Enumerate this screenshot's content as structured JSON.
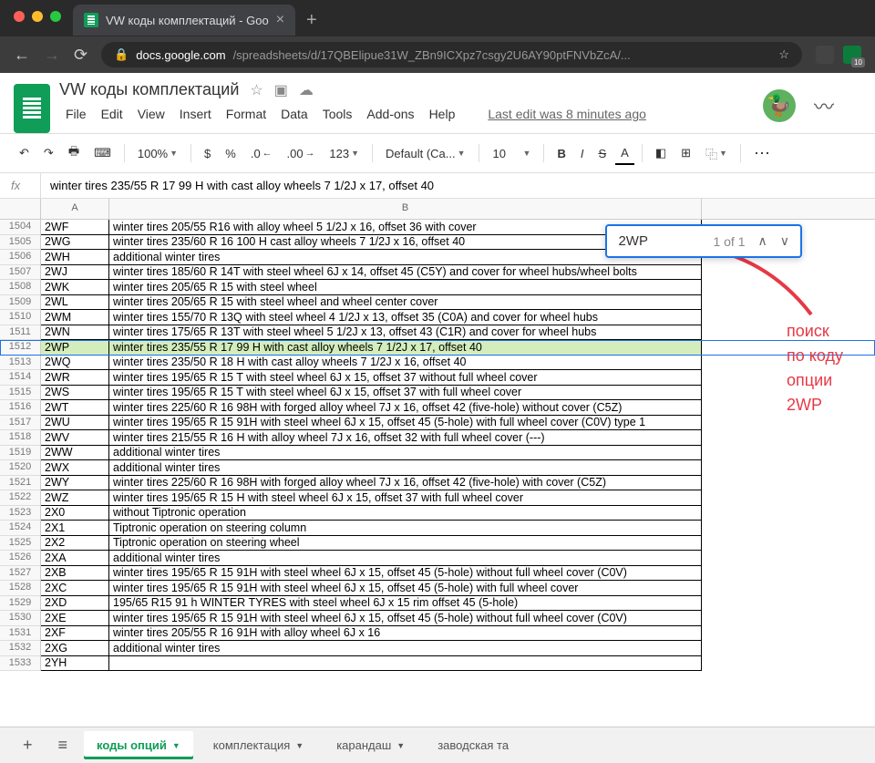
{
  "browser": {
    "tab_title": "VW коды комплектаций - Goo",
    "url_domain": "docs.google.com",
    "url_path": "/spreadsheets/d/17QBElipue31W_ZBn9ICXpz7csgy2U6AY90ptFNVbZcA/...",
    "ext_badge": "10"
  },
  "doc": {
    "title": "VW коды комплектаций",
    "last_edit": "Last edit was 8 minutes ago"
  },
  "menu": {
    "file": "File",
    "edit": "Edit",
    "view": "View",
    "insert": "Insert",
    "format": "Format",
    "data": "Data",
    "tools": "Tools",
    "addons": "Add-ons",
    "help": "Help"
  },
  "toolbar": {
    "zoom": "100%",
    "currency": "$",
    "percent": "%",
    "dec_dec": ".0",
    "dec_inc": ".00",
    "num123": "123",
    "font": "Default (Ca...",
    "font_size": "10",
    "bold": "B",
    "italic": "I",
    "strike": "S",
    "textcolor": "A"
  },
  "formula": {
    "fx": "fx",
    "value": "winter tires 235/55 R 17 99 H with cast alloy wheels 7 1/2J x 17, offset 40"
  },
  "columns": {
    "A": "A",
    "B": "B"
  },
  "find": {
    "query": "2WP",
    "count": "1 of 1"
  },
  "annotation": {
    "l1": "поиск",
    "l2": "по коду",
    "l3": "опции",
    "l4": "2WP"
  },
  "rows": [
    {
      "n": "1504",
      "a": "2WF",
      "b": "winter tires 205/55 R16 with alloy wheel 5 1/2J x 16, offset 36 with cover"
    },
    {
      "n": "1505",
      "a": "2WG",
      "b": "winter tires 235/60 R 16 100 H cast alloy wheels 7 1/2J x 16, offset 40"
    },
    {
      "n": "1506",
      "a": "2WH",
      "b": "additional winter tires"
    },
    {
      "n": "1507",
      "a": "2WJ",
      "b": "winter tires 185/60 R 14T with steel wheel 6J x 14, offset 45 (C5Y) and cover for wheel hubs/wheel bolts"
    },
    {
      "n": "1508",
      "a": "2WK",
      "b": "winter tires 205/65 R 15 with steel wheel"
    },
    {
      "n": "1509",
      "a": "2WL",
      "b": "winter tires 205/65 R 15 with steel wheel and wheel center cover"
    },
    {
      "n": "1510",
      "a": "2WM",
      "b": "winter tires 155/70 R 13Q with steel wheel 4 1/2J x 13, offset 35 (C0A) and cover for wheel hubs"
    },
    {
      "n": "1511",
      "a": "2WN",
      "b": "winter tires 175/65 R 13T with steel wheel 5 1/2J x 13, offset 43 (C1R) and cover for wheel hubs"
    },
    {
      "n": "1512",
      "a": "2WP",
      "b": "winter tires 235/55 R 17 99 H with cast alloy wheels 7 1/2J x 17, offset 40",
      "hl": true
    },
    {
      "n": "1513",
      "a": "2WQ",
      "b": "winter tires 235/50 R 18 H with cast alloy wheels 7 1/2J x 16, offset 40"
    },
    {
      "n": "1514",
      "a": "2WR",
      "b": "winter tires 195/65 R 15 T with steel wheel 6J x 15, offset 37 without full wheel cover"
    },
    {
      "n": "1515",
      "a": "2WS",
      "b": "winter tires 195/65 R 15 T with steel wheel 6J x 15, offset 37 with full wheel cover"
    },
    {
      "n": "1516",
      "a": "2WT",
      "b": "winter tires 225/60 R 16 98H with forged alloy wheel 7J x 16, offset 42 (five-hole) without cover (C5Z)"
    },
    {
      "n": "1517",
      "a": "2WU",
      "b": "winter tires 195/65 R 15 91H with steel wheel 6J x 15, offset 45 (5-hole) with full wheel cover (C0V) type 1"
    },
    {
      "n": "1518",
      "a": "2WV",
      "b": "winter tires 215/55 R 16 H with alloy wheel 7J x 16, offset 32 with full wheel cover (---)"
    },
    {
      "n": "1519",
      "a": "2WW",
      "b": "additional winter tires"
    },
    {
      "n": "1520",
      "a": "2WX",
      "b": "additional winter tires"
    },
    {
      "n": "1521",
      "a": "2WY",
      "b": "winter tires 225/60 R 16 98H with forged alloy wheel 7J x 16, offset 42 (five-hole) with cover (C5Z)"
    },
    {
      "n": "1522",
      "a": "2WZ",
      "b": "winter tires 195/65 R 15 H with steel wheel 6J x 15, offset 37 with full wheel cover"
    },
    {
      "n": "1523",
      "a": "2X0",
      "b": "without Tiptronic operation"
    },
    {
      "n": "1524",
      "a": "2X1",
      "b": "Tiptronic operation on steering column"
    },
    {
      "n": "1525",
      "a": "2X2",
      "b": "Tiptronic operation on steering wheel"
    },
    {
      "n": "1526",
      "a": "2XA",
      "b": "additional winter tires"
    },
    {
      "n": "1527",
      "a": "2XB",
      "b": "winter tires 195/65 R 15 91H with steel wheel 6J x 15, offset 45 (5-hole) without full wheel cover (C0V)"
    },
    {
      "n": "1528",
      "a": "2XC",
      "b": "winter tires 195/65 R 15 91H with steel wheel 6J x 15, offset 45 (5-hole) with full wheel cover"
    },
    {
      "n": "1529",
      "a": "2XD",
      "b": "195/65 R15 91 h WINTER TYRES with steel wheel 6J x 15 rim offset 45 (5-hole)"
    },
    {
      "n": "1530",
      "a": "2XE",
      "b": "winter tires 195/65 R 15 91H with steel wheel 6J x 15, offset 45 (5-hole) without full wheel cover (C0V)"
    },
    {
      "n": "1531",
      "a": "2XF",
      "b": "winter tires 205/55 R 16 91H with alloy wheel 6J x 16"
    },
    {
      "n": "1532",
      "a": "2XG",
      "b": "additional winter tires"
    },
    {
      "n": "1533",
      "a": "2YH",
      "b": ""
    }
  ],
  "sheets": {
    "active": "коды опций",
    "t2": "комплектация",
    "t3": "карандаш",
    "t4": "заводская та"
  }
}
